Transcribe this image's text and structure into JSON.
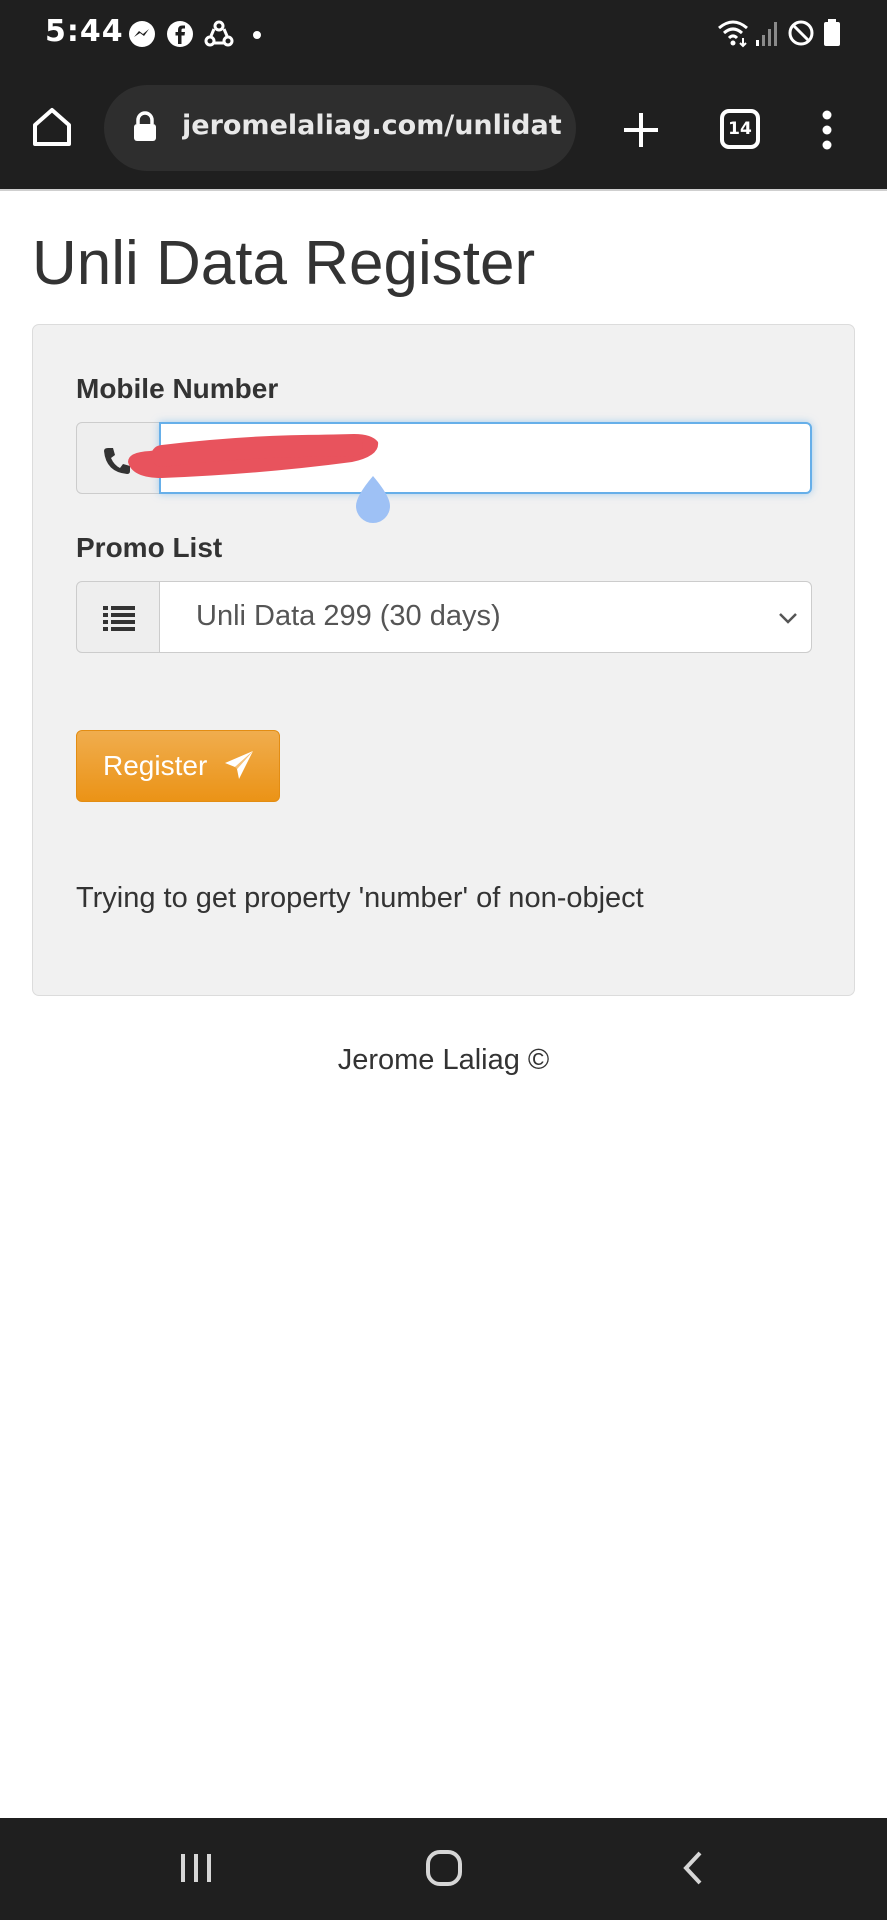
{
  "status_bar": {
    "time": "5:44",
    "notification_icons": [
      "messenger-icon",
      "facebook-icon",
      "sync-icon",
      "dot-icon"
    ],
    "system_icons": [
      "wifi-icon",
      "signal-icon",
      "do-not-disturb-icon",
      "battery-icon"
    ]
  },
  "browser": {
    "url": "jeromelaliag.com/unlidata",
    "tab_count": "14"
  },
  "page": {
    "title": "Unli Data Register",
    "mobile_label": "Mobile Number",
    "mobile_value": "",
    "promo_label": "Promo List",
    "promo_selected": "Unli Data 299 (30 days)",
    "register_label": "Register",
    "error_message": "Trying to get property 'number' of non-object",
    "footer": "Jerome Laliag ©"
  },
  "colors": {
    "accent_orange": "#f0ad4e",
    "focus_blue": "#66afe9",
    "redaction_red": "#e8535d"
  }
}
